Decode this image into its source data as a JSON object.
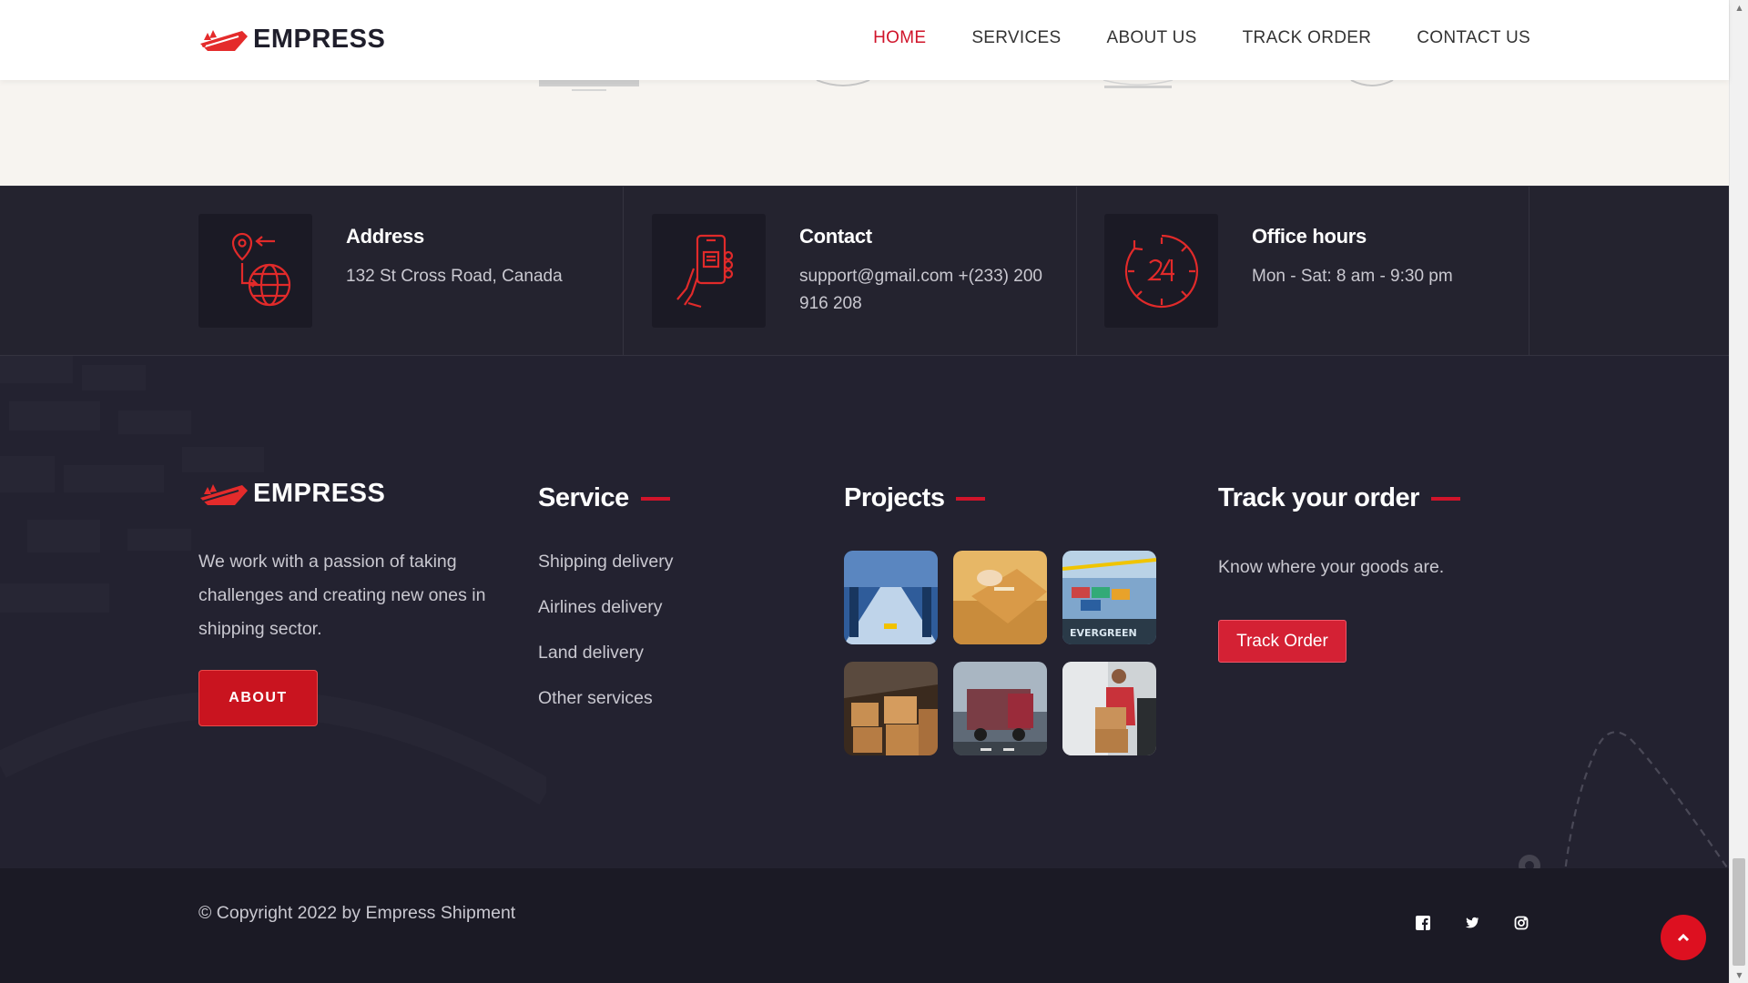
{
  "brand": {
    "name": "EMPRESS",
    "accent": "#d0142a"
  },
  "nav": {
    "items": [
      {
        "label": "HOME",
        "active": true
      },
      {
        "label": "SERVICES",
        "active": false
      },
      {
        "label": "ABOUT US",
        "active": false
      },
      {
        "label": "TRACK ORDER",
        "active": false
      },
      {
        "label": "CONTACT US",
        "active": false
      }
    ]
  },
  "info": {
    "address": {
      "title": "Address",
      "text": "132 St Cross Road, Canada",
      "icon": "globe-pin-icon"
    },
    "contact": {
      "title": "Contact",
      "text": "support@gmail.com +(233) 200 916 208",
      "icon": "phone-hand-icon"
    },
    "hours": {
      "title": "Office hours",
      "text": "Mon - Sat: 8 am - 9:30 pm",
      "icon": "clock-24-icon"
    }
  },
  "footer": {
    "about_text": "We work with a passion of taking challenges and creating new ones in shipping sector.",
    "about_button": "ABOUT",
    "service_title": "Service",
    "services": [
      "Shipping delivery",
      "Airlines delivery",
      "Land delivery",
      "Other services"
    ],
    "projects_title": "Projects",
    "project_badge": "EVERGREEN",
    "track_title": "Track your order",
    "track_text": "Know where your goods are.",
    "track_button": "Track Order"
  },
  "bottom": {
    "copyright": "© Copyright 2022 by Empress Shipment",
    "socials": [
      "facebook-icon",
      "twitter-icon",
      "instagram-icon"
    ]
  }
}
